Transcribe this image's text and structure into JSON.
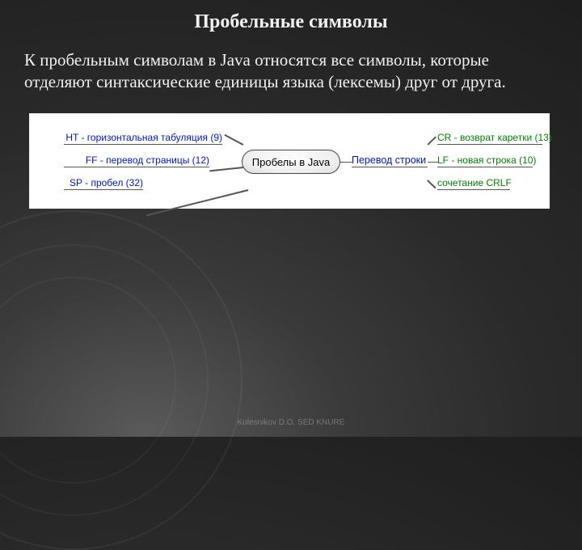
{
  "title": "Пробельные символы",
  "paragraph": "К пробельным символам в Java относятся все символы, которые отделяют синтаксические единицы языка (лексемы) друг от друга.",
  "diagram": {
    "central": "Пробелы в Java",
    "left": [
      "HT - горизонтальная табуляция (9)",
      "FF - перевод страницы (12)",
      "SP - пробел (32)"
    ],
    "mid": "Перевод строки",
    "right": [
      "CR - возврат каретки (13)",
      "LF - новая строка (10)",
      "сочетание CRLF"
    ]
  },
  "footer": "Kolesnikov D.O. SED KNURE"
}
